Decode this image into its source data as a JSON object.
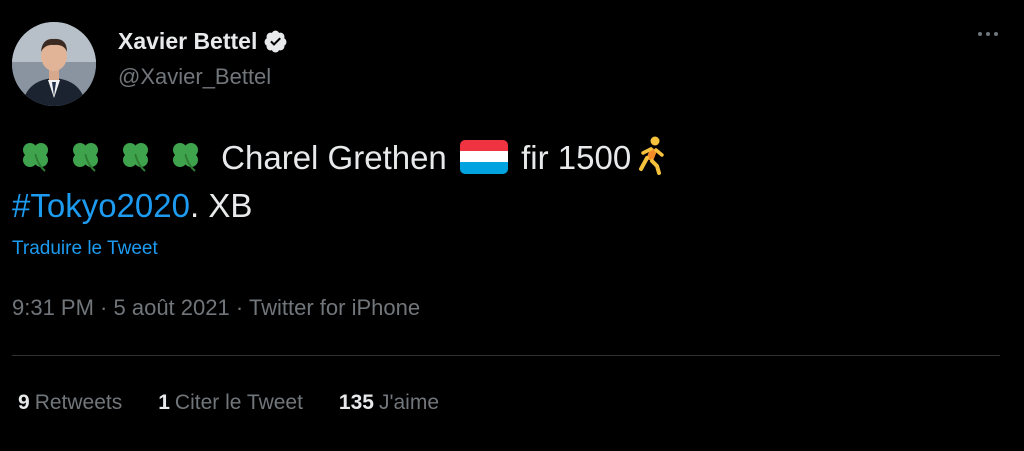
{
  "author": {
    "name": "Xavier Bettel",
    "handle": "@Xavier_Bettel",
    "avatar_icon": "person-in-suit-avatar",
    "verified_icon": "verified-badge-icon"
  },
  "tweet": {
    "leading_emoji": [
      "shamrock",
      "shamrock",
      "shamrock",
      "shamrock"
    ],
    "text_part1": "Charel Grethen",
    "flag_icon": "luxembourg-flag",
    "text_part2": "fir 1500",
    "runner_icon": "person-running",
    "hashtag": "#Tokyo2020",
    "text_part3": ". XB"
  },
  "translate_label": "Traduire le Tweet",
  "meta": {
    "time": "9:31 PM",
    "separator": " · ",
    "date": "5 août 2021",
    "source": "Twitter for iPhone"
  },
  "stats": [
    {
      "count": "9",
      "label": "Retweets"
    },
    {
      "count": "1",
      "label": "Citer le Tweet"
    },
    {
      "count": "135",
      "label": "J'aime"
    }
  ],
  "colors": {
    "background": "#000000",
    "text": "#e7e9ea",
    "muted": "#71767b",
    "link": "#1d9bf0",
    "divider": "#2f3336"
  }
}
